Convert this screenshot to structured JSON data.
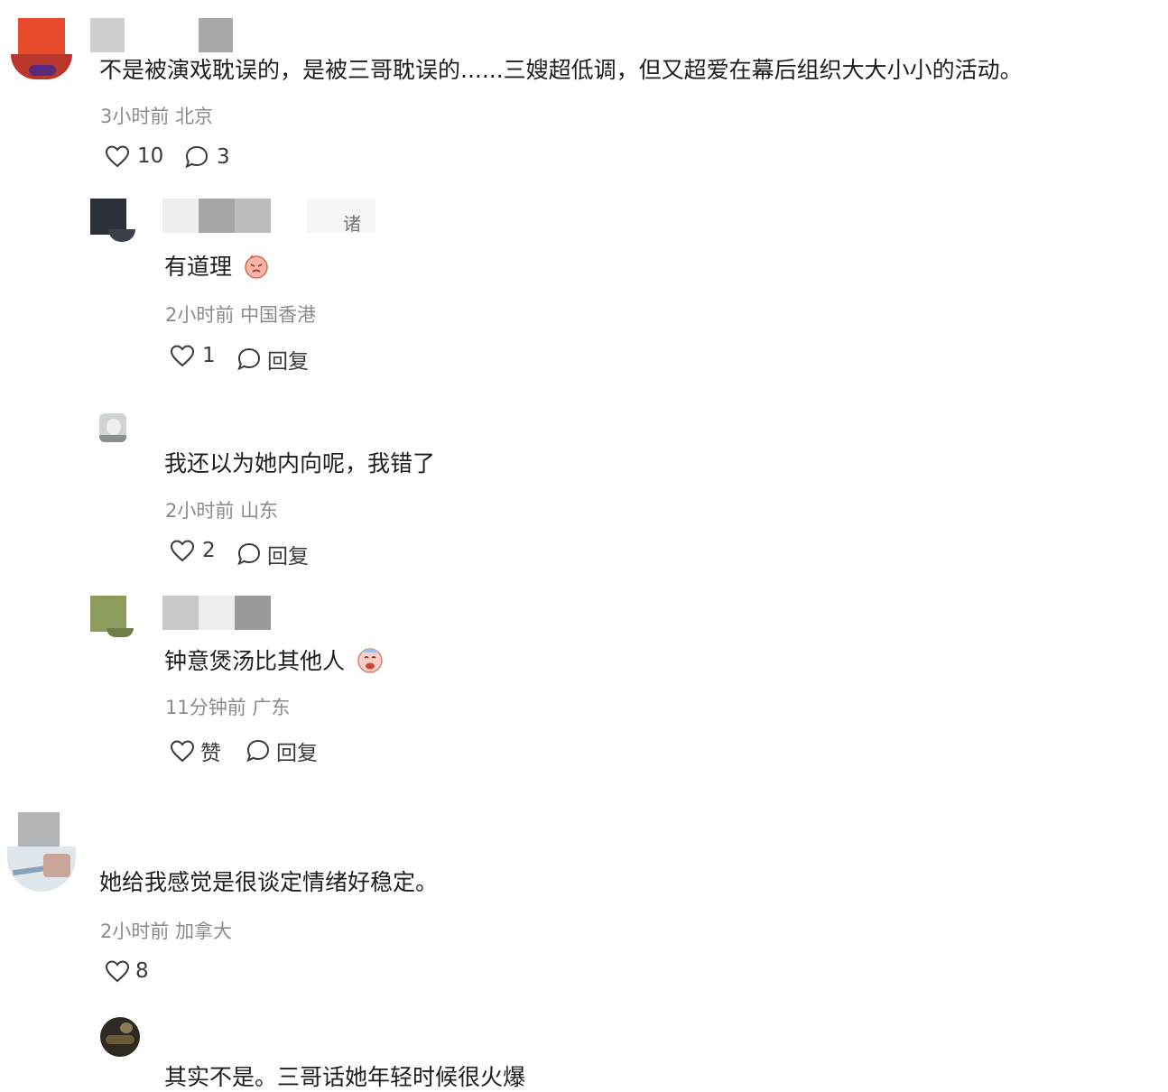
{
  "comments": [
    {
      "text": "不是被演戏耽误的，是被三哥耽误的......三嫂超低调，但又超爱在幕后组织大大小小的活动。",
      "time": "3小时前",
      "location": "北京",
      "likes": "10",
      "replies": "3",
      "replies_list": [
        {
          "name_tail": "诸",
          "text": "有道理",
          "time": "2小时前",
          "location": "中国香港",
          "likes": "1",
          "reply_label": "回复"
        },
        {
          "text": "我还以为她内向呢，我错了",
          "time": "2小时前",
          "location": "山东",
          "likes": "2",
          "reply_label": "回复"
        },
        {
          "text": "钟意煲汤比其他人",
          "time": "11分钟前",
          "location": "广东",
          "likes": "赞",
          "reply_label": "回复"
        }
      ]
    },
    {
      "text": "她给我感觉是很谈定情绪好稳定。",
      "time": "2小时前",
      "location": "加拿大",
      "likes": "8",
      "replies_list": [
        {
          "text": "其实不是。三哥话她年轻时候很火爆"
        }
      ]
    }
  ],
  "colors": {
    "meta": "#8b8b8b",
    "text": "#1e1e1e",
    "icon": "#3a3a3a"
  },
  "icons": [
    "heart-icon",
    "comment-bubble-icon",
    "face-emoji-icon"
  ]
}
